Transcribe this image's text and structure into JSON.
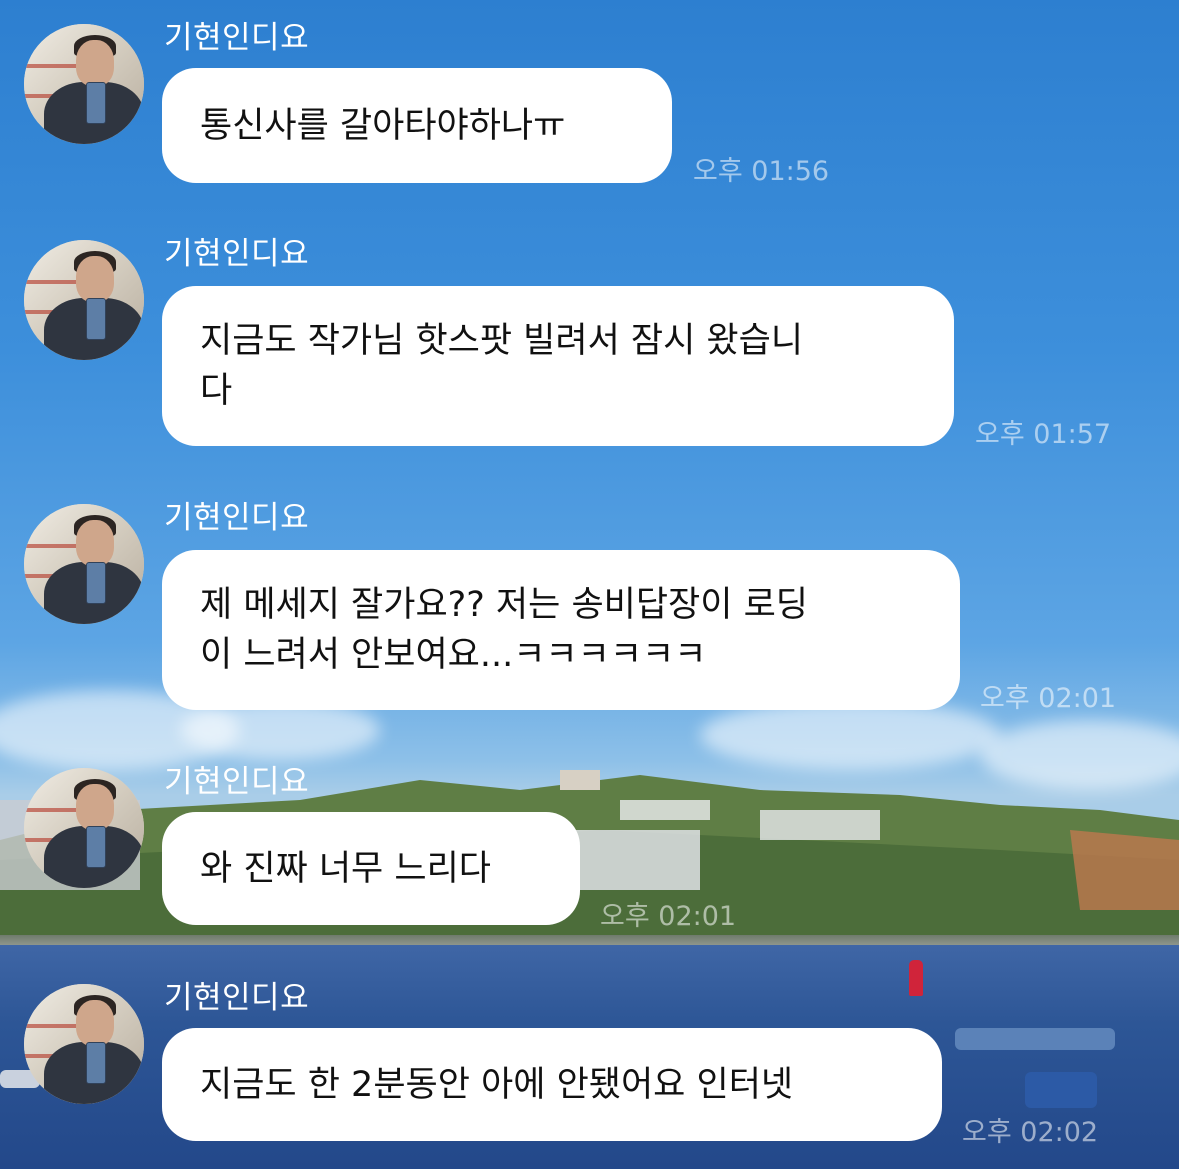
{
  "chat": {
    "messages": [
      {
        "sender": "기현인디요",
        "text": "통신사를 갈아타야하나ㅠ",
        "time": "오후 01:56",
        "avatar_icon": "profile-photo"
      },
      {
        "sender": "기현인디요",
        "text": "지금도 작가님 핫스팟 빌려서 잠시 왔습니\n다",
        "time": "오후 01:57",
        "avatar_icon": "profile-photo"
      },
      {
        "sender": "기현인디요",
        "text": "제 메세지 잘가요?? 저는 송비답장이 로딩\n이 느려서 안보여요...ㅋㅋㅋㅋㅋㅋ",
        "time": "오후 02:01",
        "avatar_icon": "profile-photo"
      },
      {
        "sender": "기현인디요",
        "text": "와 진짜 너무 느리다",
        "time": "오후 02:01",
        "avatar_icon": "profile-photo"
      },
      {
        "sender": "기현인디요",
        "text": "지금도 한 2분동안 아에 안됐어요 인터넷",
        "time": "오후 02:02",
        "avatar_icon": "profile-photo"
      }
    ]
  },
  "colors": {
    "bubble": "#ffffff",
    "sender_text": "#ffffff",
    "message_text": "#111111",
    "sky": "#2d7fd0",
    "water": "#2d5696"
  }
}
